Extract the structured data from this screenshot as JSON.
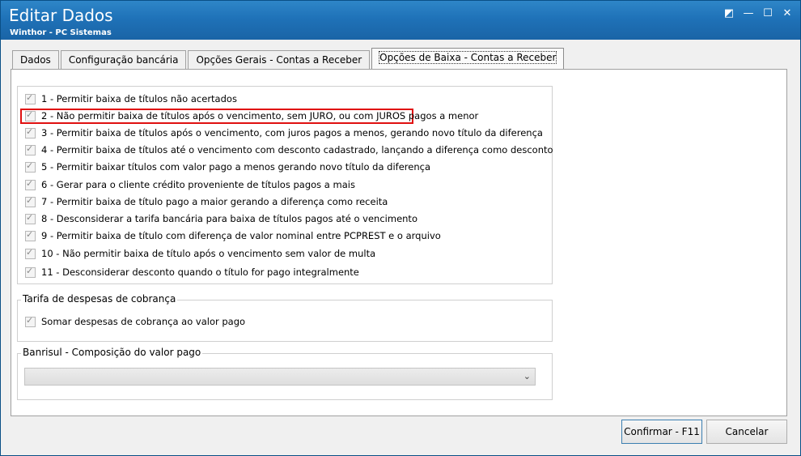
{
  "window": {
    "title": "Editar Dados",
    "subtitle": "Winthor - PC Sistemas"
  },
  "tabs": [
    {
      "label": "Dados"
    },
    {
      "label": "Configuração bancária"
    },
    {
      "label": "Opções Gerais - Contas a Receber"
    },
    {
      "label": "Opções de Baixa - Contas a Receber",
      "active": true
    }
  ],
  "options": [
    {
      "label": "1 - Permitir baixa de títulos não acertados",
      "checked": true
    },
    {
      "label": "2 - Não permitir baixa de títulos após o vencimento, sem JURO, ou com JUROS pagos a menor",
      "checked": true,
      "highlighted": true
    },
    {
      "label": "3 - Permitir baixa de títulos após o vencimento, com juros pagos a menos, gerando novo título da diferença",
      "checked": true
    },
    {
      "label": "4 - Permitir baixa de títulos até o vencimento com desconto cadastrado, lançando a diferença como desconto",
      "checked": true
    },
    {
      "label": "5 - Permitir baixar títulos com valor pago a menos gerando novo título da diferença",
      "checked": true
    },
    {
      "label": "6 - Gerar para o cliente crédito proveniente de títulos pagos a mais",
      "checked": true
    },
    {
      "label": "7 - Permitir baixa de título pago a maior gerando a diferença como receita",
      "checked": true
    },
    {
      "label": "8 - Desconsiderar a tarifa bancária para baixa de títulos pagos até o vencimento",
      "checked": true
    },
    {
      "label": "9 - Permitir baixa de título com diferença de valor nominal entre PCPREST e o arquivo",
      "checked": true
    },
    {
      "label": "10 - Não permitir baixa de título após o vencimento sem valor de multa",
      "checked": true
    },
    {
      "label": "11 - Desconsiderar desconto quando o título for pago integralmente",
      "checked": true
    }
  ],
  "tarifa": {
    "title": "Tarifa de despesas de cobrança",
    "option": {
      "label": "Somar despesas de cobrança ao valor pago",
      "checked": true
    }
  },
  "banrisul": {
    "title": "Banrisul - Composição do valor pago",
    "selected": ""
  },
  "buttons": {
    "confirm": "Confirmar - F11",
    "cancel": "Cancelar"
  },
  "colors": {
    "titlebar": "#1f72b8",
    "highlight": "#e01010"
  }
}
